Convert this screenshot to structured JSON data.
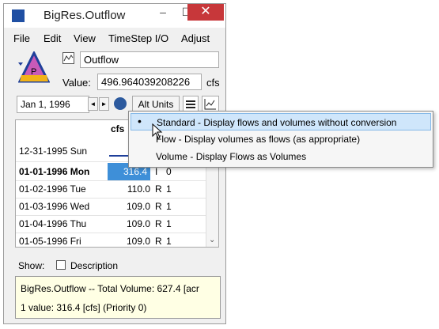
{
  "window": {
    "title": "BigRes.Outflow"
  },
  "titlebar": {
    "minimize": "–",
    "maximize": "☐",
    "close": "✕"
  },
  "menu": [
    "File",
    "Edit",
    "View",
    "TimeStep I/O",
    "Adjust"
  ],
  "slot": {
    "name": "Outflow",
    "value_label": "Value:",
    "value": "496.964039208226",
    "unit": "cfs"
  },
  "toolbar": {
    "date": "Jan 1, 1996",
    "prev": "◄",
    "next": "►",
    "alt_units": "Alt Units"
  },
  "grid": {
    "column_header": "cfs",
    "rows": [
      {
        "date": "12-31-1995 Sun",
        "value": "",
        "flag": "",
        "priority": ""
      },
      {
        "date": "01-01-1996 Mon",
        "value": "316.4",
        "flag": "I",
        "priority": "0"
      },
      {
        "date": "01-02-1996 Tue",
        "value": "110.0",
        "flag": "R",
        "priority": "1"
      },
      {
        "date": "01-03-1996 Wed",
        "value": "109.0",
        "flag": "R",
        "priority": "1"
      },
      {
        "date": "01-04-1996 Thu",
        "value": "109.0",
        "flag": "R",
        "priority": "1"
      },
      {
        "date": "01-05-1996 Fri",
        "value": "109.0",
        "flag": "R",
        "priority": "1"
      }
    ],
    "scroll_down": "⌄"
  },
  "show": {
    "label": "Show:",
    "description": "Description"
  },
  "info": {
    "line1": "BigRes.Outflow -- Total Volume: 627.4 [acr",
    "line2": "1 value:  316.4 [cfs]  (Priority 0)"
  },
  "popup": {
    "items": [
      {
        "bullet": "•",
        "label": "Standard - Display flows and volumes without conversion"
      },
      {
        "bullet": "",
        "label": "Flow - Display volumes as flows (as appropriate)"
      },
      {
        "bullet": "",
        "label": "Volume - Display Flows as Volumes"
      }
    ]
  },
  "colors": {
    "selected_cell": "#3e8fd8",
    "close_button": "#c7373a",
    "popup_highlight": "#cfe6fb",
    "info_background": "#ffffe4"
  }
}
